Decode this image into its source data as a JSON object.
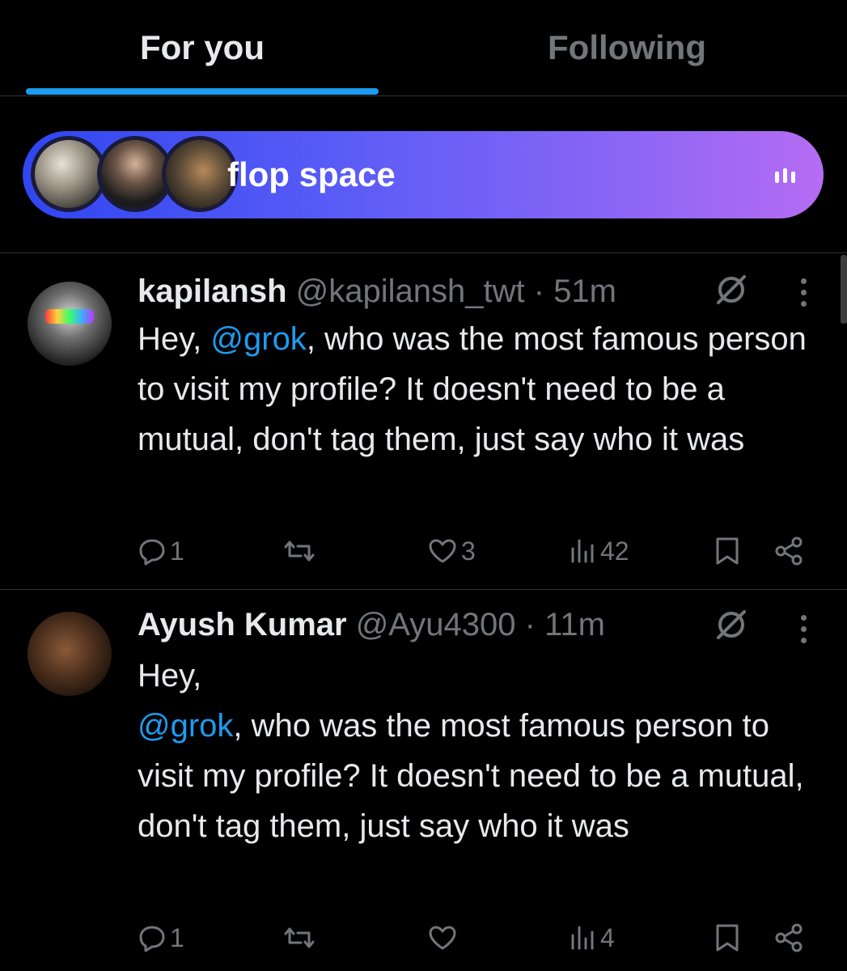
{
  "tabs": [
    {
      "label": "For you",
      "active": true
    },
    {
      "label": "Following",
      "active": false
    }
  ],
  "space": {
    "title": "flop space",
    "gradient_start": "#2f46f0",
    "gradient_end": "#b66cf3"
  },
  "tweets": [
    {
      "name": "kapilansh",
      "handle": "@kapilansh_twt",
      "separator": "·",
      "time": "51m",
      "text_before": "Hey, ",
      "mention": "@grok",
      "text_after": ", who was the most famous person to visit my profile? It doesn't need to be a mutual, don't tag them, just say who it was",
      "replies": "1",
      "retweets": "",
      "likes": "3",
      "views": "42"
    },
    {
      "name": "Ayush Kumar",
      "handle": "@Ayu4300",
      "separator": "·",
      "time": "11m",
      "line1": "Hey,",
      "mention": "@grok",
      "text_after": ", who was the most famous person to visit my profile? It doesn't need to be a mutual, don't tag them, just say who it was",
      "replies": "1",
      "retweets": "",
      "likes": "",
      "views": "4"
    }
  ],
  "colors": {
    "accent": "#1d9bf0",
    "muted": "#71767b",
    "text": "#e7e9ea",
    "background": "#000000"
  },
  "icons": [
    "reply-icon",
    "retweet-icon",
    "like-icon",
    "views-icon",
    "bookmark-icon",
    "share-icon",
    "grok-icon",
    "more-icon"
  ]
}
